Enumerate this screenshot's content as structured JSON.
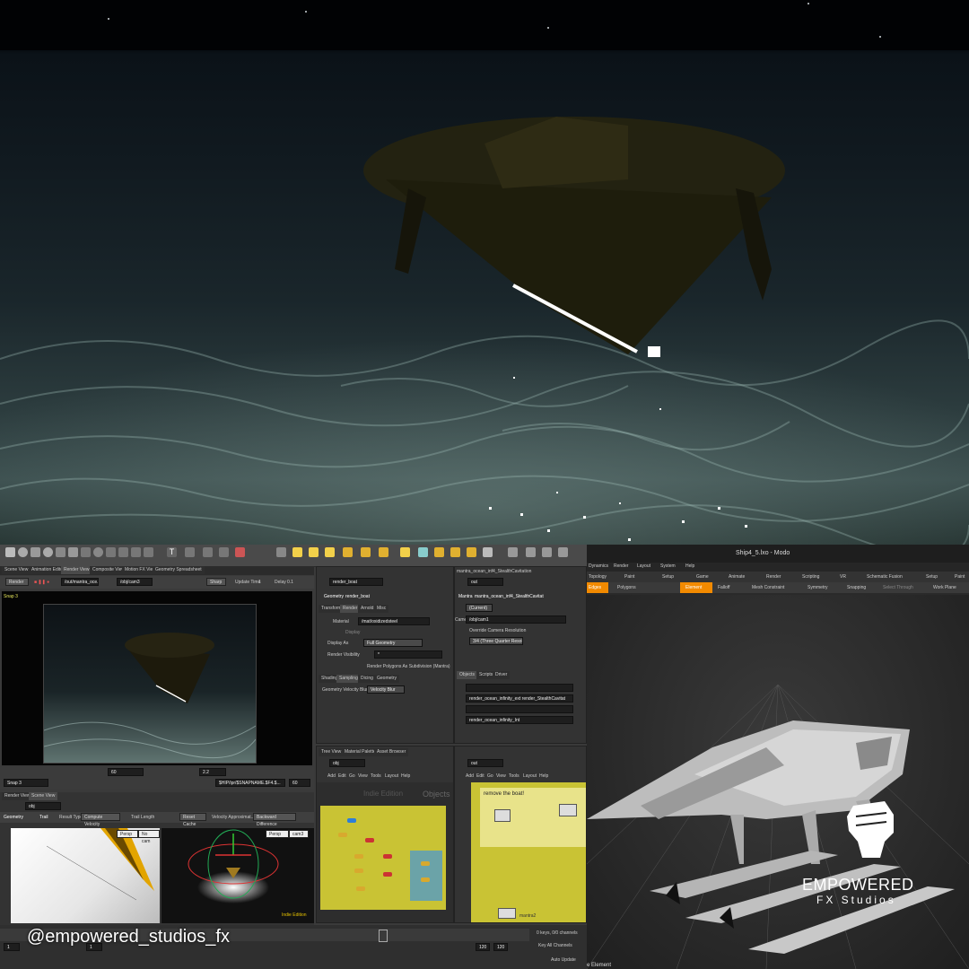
{
  "houdini": {
    "render_view": {
      "snap_label": "Snap 3",
      "camera": "/obj/cam3",
      "camera_path": "/out/mantra_oce...",
      "update_time_label": "Update Time",
      "update_time_value": "1",
      "delay_label": "Delay",
      "delay_value": "0.1",
      "sharp_label": "Sharp",
      "render_btn": "Render",
      "footer_path": "$HIP/ipr/$SNAPNAME.$F4.$...",
      "footer_frame": "60",
      "snap_dropdown": "Snap 3",
      "exposure": "2.2"
    },
    "tabs_top": [
      "Scene View",
      "Animation Editor",
      "Render View",
      "Composite View",
      "Motion FX View",
      "Geometry Spreadsheet"
    ],
    "geometry_params": {
      "path": "render_boat",
      "header_type": "Geometry",
      "header_name": "render_boat",
      "tabs": [
        "Transform",
        "Render",
        "Arnold",
        "Misc"
      ],
      "material_label": "Material",
      "material_value": "/mat/oxidizedsteel",
      "display_label": "Display",
      "display_as_label": "Display As",
      "display_as_value": "Full Geometry",
      "render_visibility_label": "Render Visibility",
      "render_visibility_value": "*",
      "subdiv_label": "Render Polygons As Subdivision (Mantra)",
      "subtabs": [
        "Shading",
        "Sampling",
        "Dicing",
        "Geometry"
      ],
      "velocity_blur_label": "Geometry Velocity Blur",
      "velocity_blur_value": "Velocity Blur"
    },
    "mantra_params": {
      "tab": "mantra_ocean_inf4_StealthCavitation",
      "path": "out",
      "header_type": "Mantra",
      "header_name": "mantra_ocean_inf4_StealthCavitat",
      "camera_label": "Camera",
      "camera_value": "/obj/cam1",
      "override_label": "Override Camera Resolution",
      "resolution_value": "3/4 (Three Quarter Resolution)",
      "current_value": "(Current)",
      "tabs": [
        "Objects",
        "Scripts",
        "Driver"
      ],
      "objects": [
        "",
        "render_ocean_infinity_ext render_StealthCavitat",
        "",
        "render_ocean_infinity_Int"
      ]
    },
    "network_left": {
      "tabs": [
        "Tree View",
        "Material Palette",
        "Asset Browser"
      ],
      "path": "obj",
      "menu": [
        "Add",
        "Edit",
        "Go",
        "View",
        "Tools",
        "Layout",
        "Help"
      ],
      "watermark": "Indie Edition",
      "context": "Objects"
    },
    "network_right": {
      "path": "out",
      "menu": [
        "Add",
        "Edit",
        "Go",
        "View",
        "Tools",
        "Layout",
        "Help"
      ],
      "sticky_note": "remove the boat!",
      "node_label": "mantra2"
    },
    "scene_bottom": {
      "tabs": [
        "Render View",
        "Scene View"
      ],
      "path": "obj",
      "toolbar": [
        "Geometry",
        "Trail",
        "Result Type",
        "Compute Velocity",
        "Trail Length",
        "Reset Cache",
        "Velocity Approximat...",
        "Backward Difference"
      ],
      "persp": "Persp",
      "cam": "cam3",
      "no_cam": "No cam",
      "watermark": "Indie Edition"
    },
    "timeline": {
      "start": "1",
      "current": "1",
      "end": "120",
      "end2": "120",
      "keys_label": "0 keys, 0/0 channels",
      "channels_label": "Key All Channels",
      "auto_update": "Auto Update"
    }
  },
  "modo": {
    "title": "Ship4_5.lxo - Modo",
    "menu": [
      "Dynamics",
      "Render",
      "Layout",
      "System",
      "Help"
    ],
    "tabs": [
      "Topology",
      "Paint",
      "Setup",
      "Game",
      "Animate",
      "Render",
      "Scripting",
      "VR",
      "Schematic Fusion",
      "Setup",
      "Paint"
    ],
    "toolbar": [
      "Edges",
      "Polygons",
      "Element",
      "Falloff",
      "Mesh Constraint",
      "Symmetry",
      "Snapping",
      "Select Through",
      "Work Plane"
    ],
    "status": "e Element"
  },
  "branding": {
    "handle": "@empowered_studios_fx",
    "logo_line1": "EMPOWERED",
    "logo_line2": "FX Studios"
  },
  "colors": {
    "houdini_yellow": "#c9c334",
    "houdini_bg": "#3a3a3a",
    "modo_orange": "#f28a00",
    "water": "#2c3c3e"
  }
}
